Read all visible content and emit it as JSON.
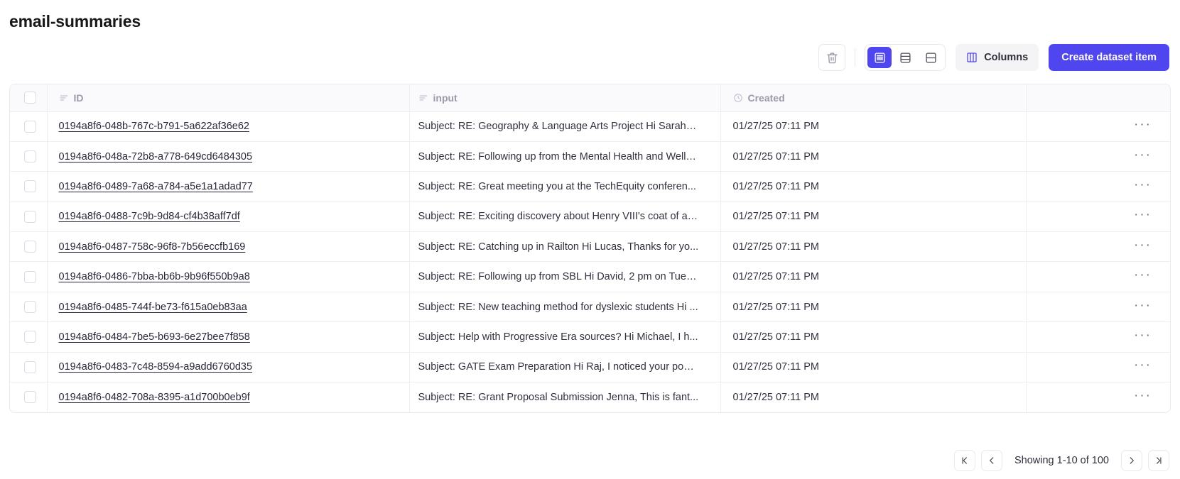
{
  "header": {
    "title": "email-summaries"
  },
  "toolbar": {
    "delete_icon": "trash-icon",
    "density_options": [
      {
        "name": "row-height-small",
        "icon": "rows-dense-icon",
        "active": true
      },
      {
        "name": "row-height-medium",
        "icon": "rows-medium-icon",
        "active": false
      },
      {
        "name": "row-height-large",
        "icon": "rows-large-icon",
        "active": false
      }
    ],
    "columns_label": "Columns",
    "columns_icon": "columns-icon",
    "create_label": "Create dataset item",
    "accent_color": "#4f46ef"
  },
  "table": {
    "columns": [
      {
        "key": "select",
        "label": "",
        "icon": "checkbox-icon"
      },
      {
        "key": "id",
        "label": "ID",
        "icon": "text-lines-icon"
      },
      {
        "key": "input",
        "label": "input",
        "icon": "text-lines-icon"
      },
      {
        "key": "created",
        "label": "Created",
        "icon": "clock-icon"
      },
      {
        "key": "actions",
        "label": "",
        "icon": ""
      }
    ],
    "rows": [
      {
        "id": "0194a8f6-048b-767c-b791-5a622af36e62",
        "input": "Subject: RE: Geography & Language Arts Project Hi Sarah, ...",
        "created": "01/27/25 07:11 PM"
      },
      {
        "id": "0194a8f6-048a-72b8-a778-649cd6484305",
        "input": "Subject: RE: Following up from the Mental Health and Welln...",
        "created": "01/27/25 07:11 PM"
      },
      {
        "id": "0194a8f6-0489-7a68-a784-a5e1a1adad77",
        "input": "Subject: RE: Great meeting you at the TechEquity conferen...",
        "created": "01/27/25 07:11 PM"
      },
      {
        "id": "0194a8f6-0488-7c9b-9d84-cf4b38aff7df",
        "input": "Subject: RE: Exciting discovery about Henry VIII's coat of ar...",
        "created": "01/27/25 07:11 PM"
      },
      {
        "id": "0194a8f6-0487-758c-96f8-7b56eccfb169",
        "input": "Subject: RE: Catching up in Railton Hi Lucas, Thanks for yo...",
        "created": "01/27/25 07:11 PM"
      },
      {
        "id": "0194a8f6-0486-7bba-bb6b-9b96f550b9a8",
        "input": "Subject: RE: Following up from SBL Hi David, 2 pm on Tues...",
        "created": "01/27/25 07:11 PM"
      },
      {
        "id": "0194a8f6-0485-744f-be73-f615a0eb83aa",
        "input": "Subject: RE: New teaching method for dyslexic students Hi ...",
        "created": "01/27/25 07:11 PM"
      },
      {
        "id": "0194a8f6-0484-7be5-b693-6e27bee7f858",
        "input": "Subject: Help with Progressive Era sources? Hi Michael, I h...",
        "created": "01/27/25 07:11 PM"
      },
      {
        "id": "0194a8f6-0483-7c48-8594-a9add6760d35",
        "input": "Subject: GATE Exam Preparation Hi Raj, I noticed your post ...",
        "created": "01/27/25 07:11 PM"
      },
      {
        "id": "0194a8f6-0482-708a-8395-a1d700b0eb9f",
        "input": "Subject: RE: Grant Proposal Submission Jenna, This is fant...",
        "created": "01/27/25 07:11 PM"
      }
    ],
    "row_menu_glyph": "···"
  },
  "pagination": {
    "first_icon": "first-page-icon",
    "prev_icon": "chevron-left-icon",
    "status": "Showing 1-10 of 100",
    "next_icon": "chevron-right-icon",
    "last_icon": "last-page-icon"
  }
}
